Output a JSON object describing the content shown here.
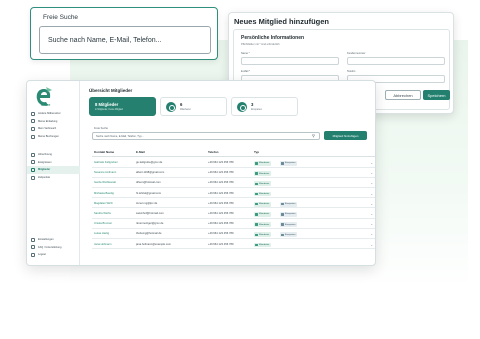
{
  "search_card": {
    "label": "Freie Suche",
    "value": "Suche nach Name, E-Mail, Telefon..."
  },
  "modal": {
    "title": "Neues Mitglied hinzufügen",
    "section": "Persönliche Informationen",
    "required_note": "Pflichtfelder mit * sind erforderlich",
    "fields": [
      {
        "label": "Name *"
      },
      {
        "label": "Kundennummer"
      },
      {
        "label": "E-Mail *"
      },
      {
        "label": "Telefon"
      }
    ],
    "cancel_label": "Abbrechen",
    "save_label": "Speichern"
  },
  "app": {
    "logo_text": "share",
    "sidebar": {
      "top": [
        {
          "label": "Andere Mitbenutzer"
        },
        {
          "label": "Meine Einladung"
        },
        {
          "label": "Mein Verbrauch"
        },
        {
          "label": "Meine Buchungen"
        }
      ],
      "middle": [
        {
          "label": "Abrechnung"
        },
        {
          "label": "Ereignissen"
        },
        {
          "label": "Mitglieder",
          "active": true
        },
        {
          "label": "Zeitpunkte"
        }
      ],
      "bottom": [
        {
          "label": "Einstellungen"
        },
        {
          "label": "FAQ / Unterstützung"
        },
        {
          "label": "Logout"
        }
      ]
    },
    "title": "Übersicht Mitglieder",
    "stats": [
      {
        "value": "8 Mitglieder",
        "sub": "in Mitglieder, Keine Mitglied"
      },
      {
        "value": "6",
        "sub": "Mitarbeiter"
      },
      {
        "value": "3",
        "sub": "Einsparten"
      }
    ],
    "filter_label": "Freie Suche",
    "filter_placeholder": "Suche nach Name, E-Mail, Telefon, Typ...",
    "add_button": "Mitglied hinzufügen",
    "columns": [
      "Kontakt Name",
      "E-Mail",
      "Telefon",
      "Typ"
    ],
    "rows": [
      {
        "name": "Gabriele Kellgruben",
        "email": "gu.kellgrube@gmx.de",
        "phone": "+49 664 123 456 789",
        "tags": [
          "Mitarbeiter",
          "Einsparten"
        ]
      },
      {
        "name": "Susanne Hofmann",
        "email": "albert.1198@gmail.com",
        "phone": "+49 664 123 456 789",
        "tags": [
          "Mitarbeiter"
        ]
      },
      {
        "name": "Gerda Wroblewski",
        "email": "drleon@hotmail.com",
        "phone": "+49 664 123 456 789",
        "tags": [
          "Mitarbeiter"
        ]
      },
      {
        "name": "Michaela Baudig",
        "email": "ht.lehriel@gmail.com",
        "phone": "+49 664 123 456 789",
        "tags": [
          "Mitarbeiter"
        ]
      },
      {
        "name": "Magdalen Wirth",
        "email": "tomer.mg@tpc.de",
        "phone": "+49 664 123 456 789",
        "tags": [
          "Mitarbeiter",
          "Einsparten"
        ]
      },
      {
        "name": "Sandra Weihs",
        "email": "sweinhof@hotmail.com",
        "phone": "+49 664 123 456 789",
        "tags": [
          "Mitarbeiter",
          "Einsparten"
        ]
      },
      {
        "name": "Ursula Brunner",
        "email": "rknermetzger@gmx.de",
        "phone": "+49 664 123 456 789",
        "tags": [
          "Mitarbeiter",
          "Einsparten"
        ]
      },
      {
        "name": "Lukas Hartig",
        "email": "thebeing@hotmail.de",
        "phone": "+49 664 123 456 789",
        "tags": [
          "Mitarbeiter",
          "Einsparten"
        ]
      },
      {
        "name": "Jana Hofmann",
        "email": "jana.hofmann@example.com",
        "phone": "+49 664 123 456 789",
        "tags": [
          "Mitarbeiter"
        ]
      }
    ]
  }
}
